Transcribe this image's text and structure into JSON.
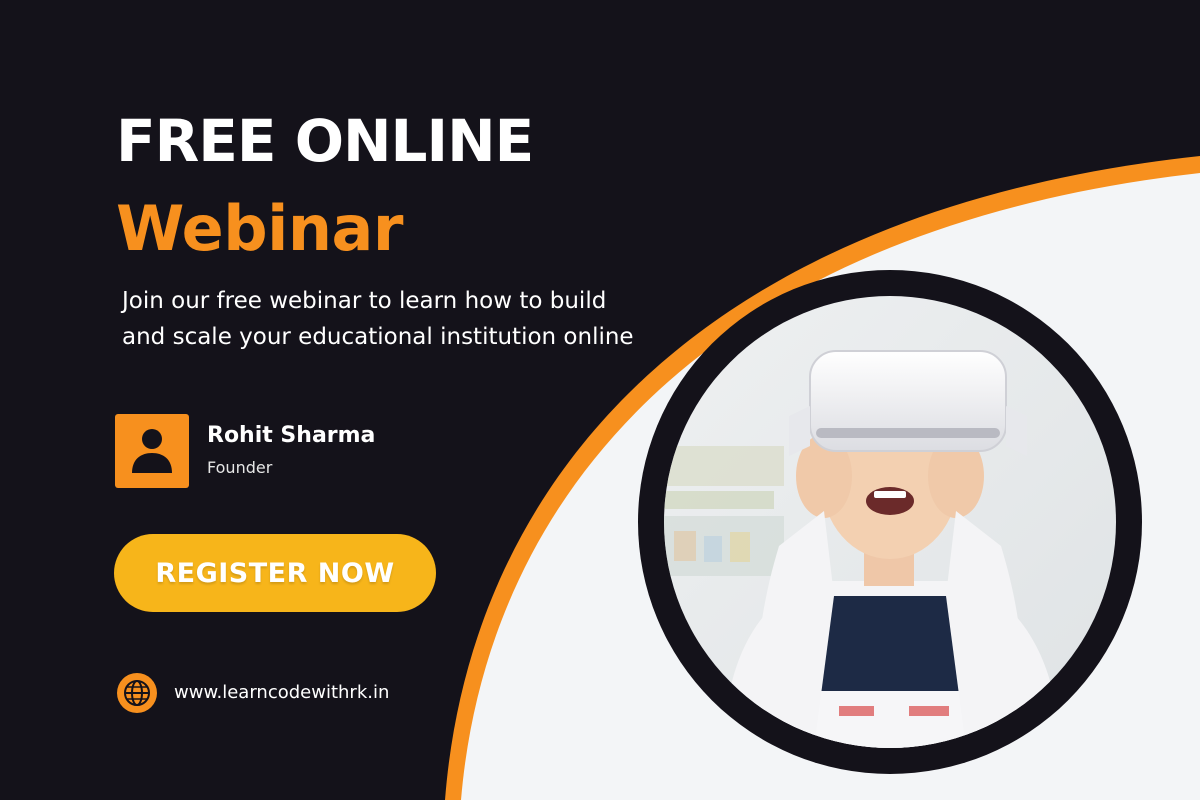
{
  "banner": {
    "headline": "FREE ONLINE",
    "subheadline": "Webinar",
    "description": "Join our free webinar to learn how to build and scale your educational institution online",
    "speaker": {
      "name": "Rohit Sharma",
      "role": "Founder",
      "avatar_icon": "user-icon"
    },
    "cta_label": "REGISTER NOW",
    "website": {
      "url": "www.learncodewithrk.in",
      "icon": "globe-icon"
    }
  },
  "colors": {
    "background": "#14121a",
    "accent_orange": "#f7901e",
    "button_yellow": "#f7b51a",
    "panel_light": "#f3f5f7",
    "text_white": "#ffffff"
  }
}
